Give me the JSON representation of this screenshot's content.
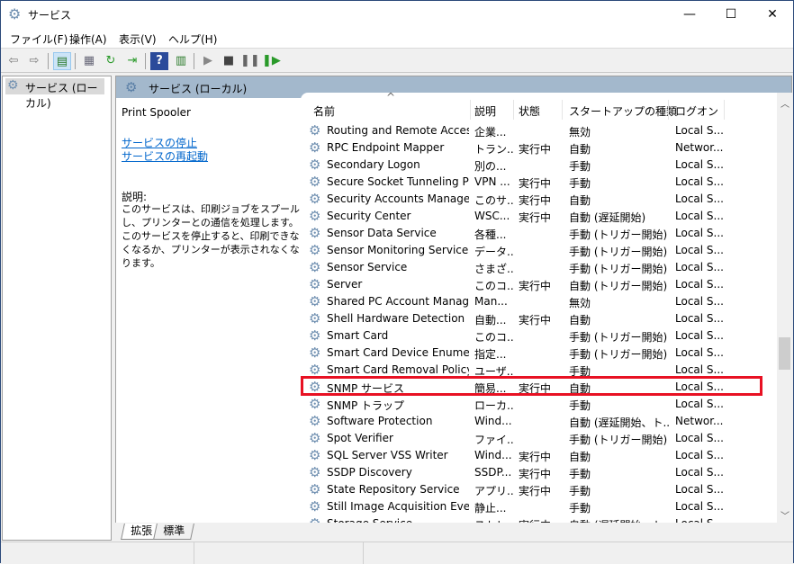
{
  "window": {
    "title": "サービス",
    "minimize": "—",
    "maximize": "☐",
    "close": "✕"
  },
  "menu": [
    "ファイル(F)",
    "操作(A)",
    "表示(V)",
    "ヘルプ(H)"
  ],
  "toolbar": [
    "back-icon",
    "forward-icon",
    "show-hide-console-tree-icon",
    "properties-icon",
    "refresh-icon",
    "export-list-icon",
    "help-icon",
    "action-pane-icon",
    "start-icon",
    "stop-icon",
    "pause-icon",
    "resume-icon"
  ],
  "tree": {
    "item": "サービス (ローカル)"
  },
  "panel": {
    "header": "サービス (ローカル)"
  },
  "details": {
    "selected": "Print Spooler",
    "stop_link": "サービスの停止",
    "restart_link": "サービスの再起動",
    "desc_label": "説明:",
    "desc": "このサービスは、印刷ジョブをスプールし、プリンターとの通信を処理します。このサービスを停止すると、印刷できなくなるか、プリンターが表示されなくなります。"
  },
  "columns": [
    "名前",
    "説明",
    "状態",
    "スタートアップの種類",
    "ログオン"
  ],
  "sort_indicator": "^",
  "rows": [
    [
      "Routing and Remote Access",
      "企業...",
      "",
      "無効",
      "Local S..."
    ],
    [
      "RPC Endpoint Mapper",
      "トラン...",
      "実行中",
      "自動",
      "Networ..."
    ],
    [
      "Secondary Logon",
      "別の...",
      "",
      "手動",
      "Local S..."
    ],
    [
      "Secure Socket Tunneling Pr...",
      "VPN ...",
      "実行中",
      "手動",
      "Local S..."
    ],
    [
      "Security Accounts Manager",
      "このサ...",
      "実行中",
      "自動",
      "Local S..."
    ],
    [
      "Security Center",
      "WSC...",
      "実行中",
      "自動 (遅延開始)",
      "Local S..."
    ],
    [
      "Sensor Data Service",
      "各種...",
      "",
      "手動 (トリガー開始)",
      "Local S..."
    ],
    [
      "Sensor Monitoring Service",
      "データ...",
      "",
      "手動 (トリガー開始)",
      "Local S..."
    ],
    [
      "Sensor Service",
      "さまざ...",
      "",
      "手動 (トリガー開始)",
      "Local S..."
    ],
    [
      "Server",
      "このコ...",
      "実行中",
      "自動 (トリガー開始)",
      "Local S..."
    ],
    [
      "Shared PC Account Manager",
      "Man...",
      "",
      "無効",
      "Local S..."
    ],
    [
      "Shell Hardware Detection",
      "自動...",
      "実行中",
      "自動",
      "Local S..."
    ],
    [
      "Smart Card",
      "このコ...",
      "",
      "手動 (トリガー開始)",
      "Local S..."
    ],
    [
      "Smart Card Device Enumera...",
      "指定...",
      "",
      "手動 (トリガー開始)",
      "Local S..."
    ],
    [
      "Smart Card Removal Policy",
      "ユーザ...",
      "",
      "手動",
      "Local S..."
    ],
    [
      "SNMP サービス",
      "簡易...",
      "実行中",
      "自動",
      "Local S..."
    ],
    [
      "SNMP トラップ",
      "ローカ...",
      "",
      "手動",
      "Local S..."
    ],
    [
      "Software Protection",
      "Wind...",
      "",
      "自動 (遅延開始、ト...",
      "Networ..."
    ],
    [
      "Spot Verifier",
      "ファイ...",
      "",
      "手動 (トリガー開始)",
      "Local S..."
    ],
    [
      "SQL Server VSS Writer",
      "Wind...",
      "実行中",
      "自動",
      "Local S..."
    ],
    [
      "SSDP Discovery",
      "SSDP...",
      "実行中",
      "手動",
      "Local S..."
    ],
    [
      "State Repository Service",
      "アプリ...",
      "実行中",
      "手動",
      "Local S..."
    ],
    [
      "Still Image Acquisition Events",
      "静止...",
      "",
      "手動",
      "Local S..."
    ],
    [
      "Storage Service",
      "ストレ...",
      "実行中",
      "自動 (遅延開始、ト...",
      "Local S..."
    ]
  ],
  "highlighted_row": "SNMP サービス",
  "highlight_color": "#e81123",
  "tabs": [
    "拡張",
    "標準"
  ],
  "active_tab": "拡張"
}
